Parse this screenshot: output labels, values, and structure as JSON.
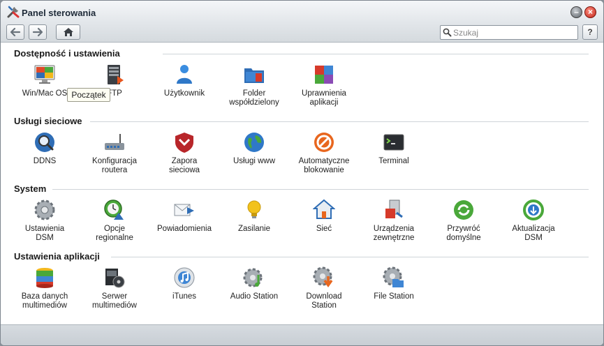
{
  "window": {
    "title": "Panel sterowania"
  },
  "toolbar": {
    "search_placeholder": "Szukaj",
    "help_label": "?"
  },
  "tooltip": "Początek",
  "sections": [
    {
      "title": "Dostępność i ustawienia",
      "items": [
        {
          "label": "Win/Mac OS",
          "icon": "win-mac-icon"
        },
        {
          "label": "FTP",
          "icon": "ftp-icon"
        },
        {
          "label": "Użytkownik",
          "icon": "user-icon"
        },
        {
          "label": "Folder\nwspółdzielony",
          "icon": "shared-folder-icon"
        },
        {
          "label": "Uprawnienia\naplikacji",
          "icon": "app-privileges-icon"
        }
      ]
    },
    {
      "title": "Usługi sieciowe",
      "items": [
        {
          "label": "DDNS",
          "icon": "ddns-icon"
        },
        {
          "label": "Konfiguracja\nroutera",
          "icon": "router-icon"
        },
        {
          "label": "Zapora\nsieciowa",
          "icon": "firewall-icon"
        },
        {
          "label": "Usługi www",
          "icon": "web-services-icon"
        },
        {
          "label": "Automatyczne\nblokowanie",
          "icon": "auto-block-icon"
        },
        {
          "label": "Terminal",
          "icon": "terminal-icon"
        }
      ]
    },
    {
      "title": "System",
      "items": [
        {
          "label": "Ustawienia\nDSM",
          "icon": "dsm-settings-icon"
        },
        {
          "label": "Opcje\nregionalne",
          "icon": "regional-options-icon"
        },
        {
          "label": "Powiadomienia",
          "icon": "notifications-icon"
        },
        {
          "label": "Zasilanie",
          "icon": "power-icon"
        },
        {
          "label": "Sieć",
          "icon": "network-icon"
        },
        {
          "label": "Urządzenia\nzewnętrzne",
          "icon": "external-devices-icon"
        },
        {
          "label": "Przywróć\ndomyślne",
          "icon": "restore-defaults-icon"
        },
        {
          "label": "Aktualizacja\nDSM",
          "icon": "dsm-update-icon"
        }
      ]
    },
    {
      "title": "Ustawienia aplikacji",
      "items": [
        {
          "label": "Baza danych\nmultimediów",
          "icon": "media-database-icon"
        },
        {
          "label": "Serwer\nmultimediów",
          "icon": "media-server-icon"
        },
        {
          "label": "iTunes",
          "icon": "itunes-icon"
        },
        {
          "label": "Audio Station",
          "icon": "audio-station-icon"
        },
        {
          "label": "Download\nStation",
          "icon": "download-station-icon"
        },
        {
          "label": "File Station",
          "icon": "file-station-icon"
        }
      ]
    }
  ]
}
